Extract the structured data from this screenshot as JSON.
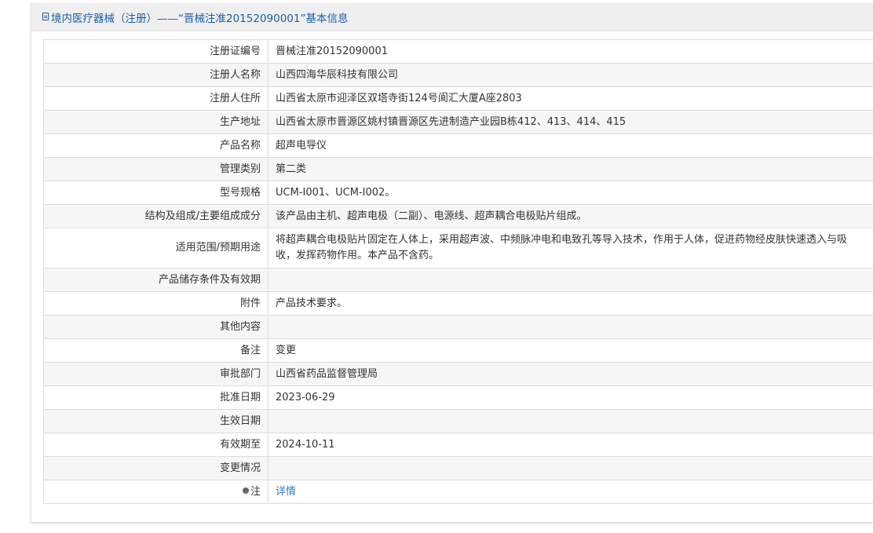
{
  "header": {
    "title": "境内医疗器械（注册）——“晋械注准20152090001”基本信息"
  },
  "rows": [
    {
      "label": "注册证编号",
      "value": "晋械注准20152090001"
    },
    {
      "label": "注册人名称",
      "value": "山西四海华辰科技有限公司"
    },
    {
      "label": "注册人住所",
      "value": "山西省太原市迎泽区双塔寺街124号阆汇大厦A座2803"
    },
    {
      "label": "生产地址",
      "value": "山西省太原市晋源区姚村镇晋源区先进制造产业园B栋412、413、414、415"
    },
    {
      "label": "产品名称",
      "value": "超声电导仪"
    },
    {
      "label": "管理类别",
      "value": "第二类"
    },
    {
      "label": "型号规格",
      "value": "UCM-Ⅰ001、UCM-Ⅰ002。"
    },
    {
      "label": "结构及组成/主要组成成分",
      "value": "该产品由主机、超声电极（二副）、电源线、超声耦合电极贴片组成。"
    },
    {
      "label": "适用范围/预期用途",
      "value": "将超声耦合电极贴片固定在人体上，采用超声波、中频脉冲电和电致孔等导入技术，作用于人体，促进药物经皮肤快速透入与吸收，发挥药物作用。本产品不含药。"
    },
    {
      "label": "产品储存条件及有效期",
      "value": ""
    },
    {
      "label": "附件",
      "value": "产品技术要求。"
    },
    {
      "label": "其他内容",
      "value": ""
    },
    {
      "label": "备注",
      "value": "变更"
    },
    {
      "label": "审批部门",
      "value": "山西省药品监督管理局"
    },
    {
      "label": "批准日期",
      "value": "2023-06-29"
    },
    {
      "label": "生效日期",
      "value": ""
    },
    {
      "label": "有效期至",
      "value": "2024-10-11"
    },
    {
      "label": "变更情况",
      "value": ""
    },
    {
      "label": "注",
      "value": "详情"
    }
  ],
  "icons": {
    "header_icon": "document-icon",
    "note_icon": "bullet-icon"
  },
  "colors": {
    "link": "#2f7fc2",
    "header_text": "#1a5fa8"
  }
}
